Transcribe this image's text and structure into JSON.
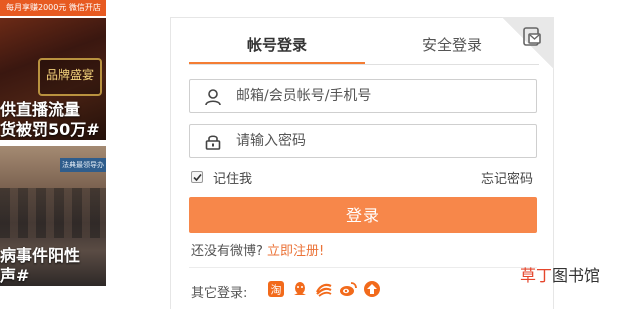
{
  "left_column": {
    "promo_banner": "每月享赚2000元 微信开店",
    "story1": {
      "logo_text": "品牌盛宴",
      "caption_line1": "供直播流量",
      "caption_line2": "货被罚50万#"
    },
    "story2": {
      "sign_text": "法典最领导办",
      "caption_line1": "病事件阳性",
      "caption_line2": "声#"
    }
  },
  "login": {
    "tabs": [
      {
        "label": "帐号登录",
        "active": true
      },
      {
        "label": "安全登录",
        "active": false
      }
    ],
    "username_placeholder": "邮箱/会员帐号/手机号",
    "password_placeholder": "请输入密码",
    "remember_label": "记住我",
    "remember_checked": true,
    "forgot_label": "忘记密码",
    "submit_label": "登录",
    "register_question": "还没有微博?",
    "register_link": "立即注册!",
    "other_login_label": "其它登录:",
    "other_login_icons": [
      "taobao-icon",
      "qq-icon",
      "china-mobile-icon",
      "sina-icon",
      "other-login-icon"
    ],
    "accent_color": "#f7874a"
  },
  "watermark": {
    "part1": "草丁",
    "part2": "图书馆"
  }
}
